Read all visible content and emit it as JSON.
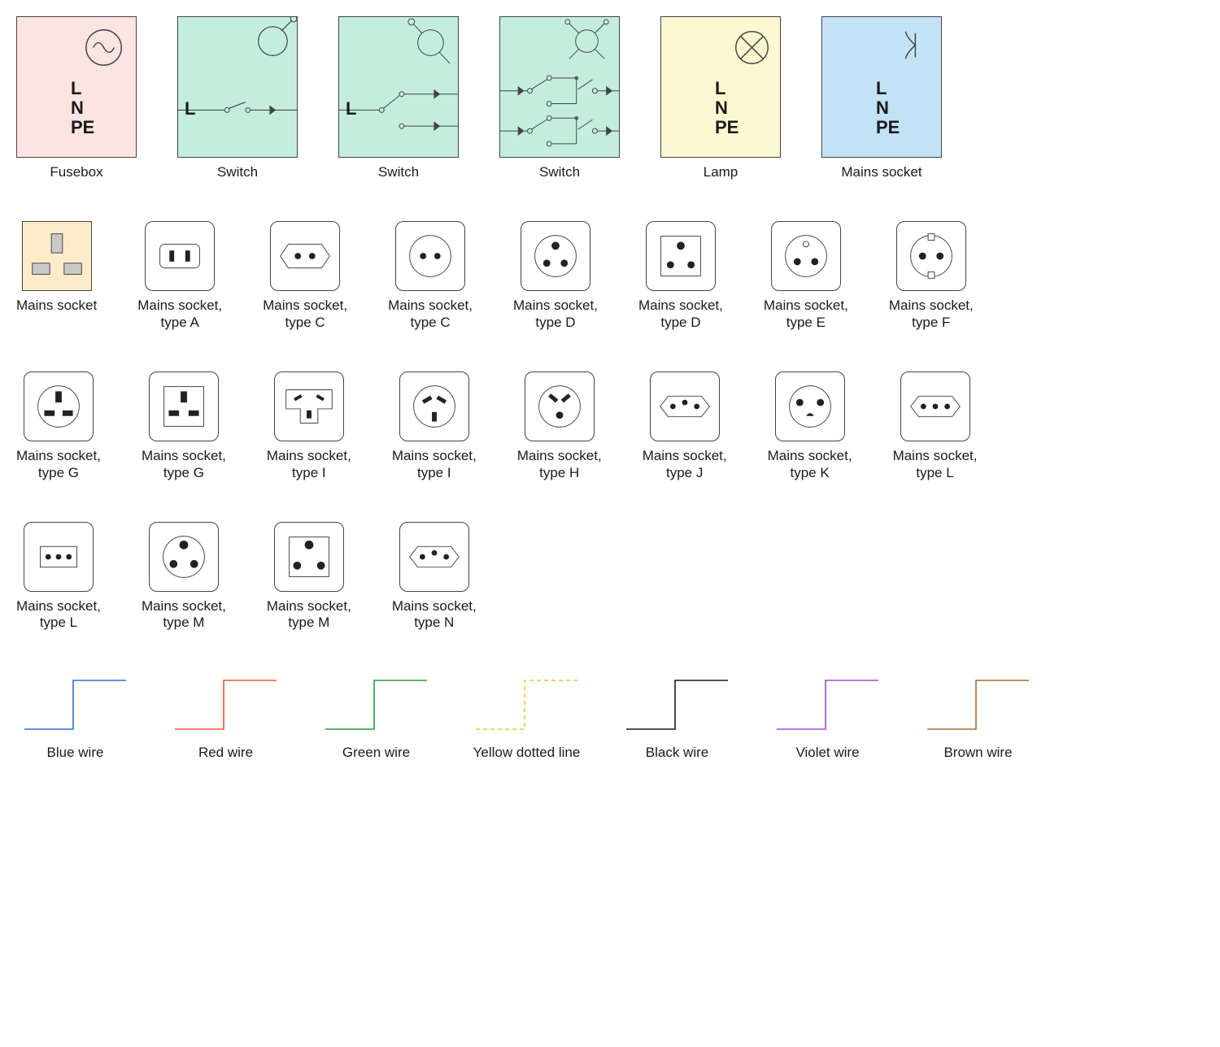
{
  "row1": [
    {
      "label": "Fusebox",
      "letters": [
        "L",
        "N",
        "PE"
      ]
    },
    {
      "label": "Switch",
      "l": "L"
    },
    {
      "label": "Switch",
      "l": "L"
    },
    {
      "label": "Switch"
    },
    {
      "label": "Lamp",
      "letters": [
        "L",
        "N",
        "PE"
      ]
    },
    {
      "label": "Mains socket",
      "letters": [
        "L",
        "N",
        "PE"
      ]
    }
  ],
  "row2": [
    {
      "l1": "Mains socket",
      "l2": ""
    },
    {
      "l1": "Mains socket,",
      "l2": "type A"
    },
    {
      "l1": "Mains socket,",
      "l2": "type C"
    },
    {
      "l1": "Mains socket,",
      "l2": "type C"
    },
    {
      "l1": "Mains socket,",
      "l2": "type D"
    },
    {
      "l1": "Mains socket,",
      "l2": "type D"
    },
    {
      "l1": "Mains socket,",
      "l2": "type E"
    },
    {
      "l1": "Mains socket,",
      "l2": "type F"
    }
  ],
  "row3": [
    {
      "l1": "Mains socket,",
      "l2": "type G"
    },
    {
      "l1": "Mains socket,",
      "l2": "type G"
    },
    {
      "l1": "Mains socket,",
      "l2": "type I"
    },
    {
      "l1": "Mains socket,",
      "l2": "type I"
    },
    {
      "l1": "Mains socket,",
      "l2": "type H"
    },
    {
      "l1": "Mains socket,",
      "l2": "type J"
    },
    {
      "l1": "Mains socket,",
      "l2": "type K"
    },
    {
      "l1": "Mains socket,",
      "l2": "type L"
    }
  ],
  "row4": [
    {
      "l1": "Mains socket,",
      "l2": "type L"
    },
    {
      "l1": "Mains socket,",
      "l2": "type M"
    },
    {
      "l1": "Mains socket,",
      "l2": "type M"
    },
    {
      "l1": "Mains socket,",
      "l2": "type N"
    }
  ],
  "wires": [
    {
      "label": "Blue wire",
      "color": "#2b6fd6",
      "dash": ""
    },
    {
      "label": "Red wire",
      "color": "#e85a2a",
      "dash": ""
    },
    {
      "label": "Green wire",
      "color": "#2b9a3f",
      "dash": ""
    },
    {
      "label": "Yellow dotted line",
      "color": "#e8c92b",
      "dash": "5,4"
    },
    {
      "label": "Black wire",
      "color": "#1a1a1a",
      "dash": ""
    },
    {
      "label": "Violet wire",
      "color": "#a24bd6",
      "dash": ""
    },
    {
      "label": "Brown wire",
      "color": "#b06a2a",
      "dash": ""
    }
  ]
}
